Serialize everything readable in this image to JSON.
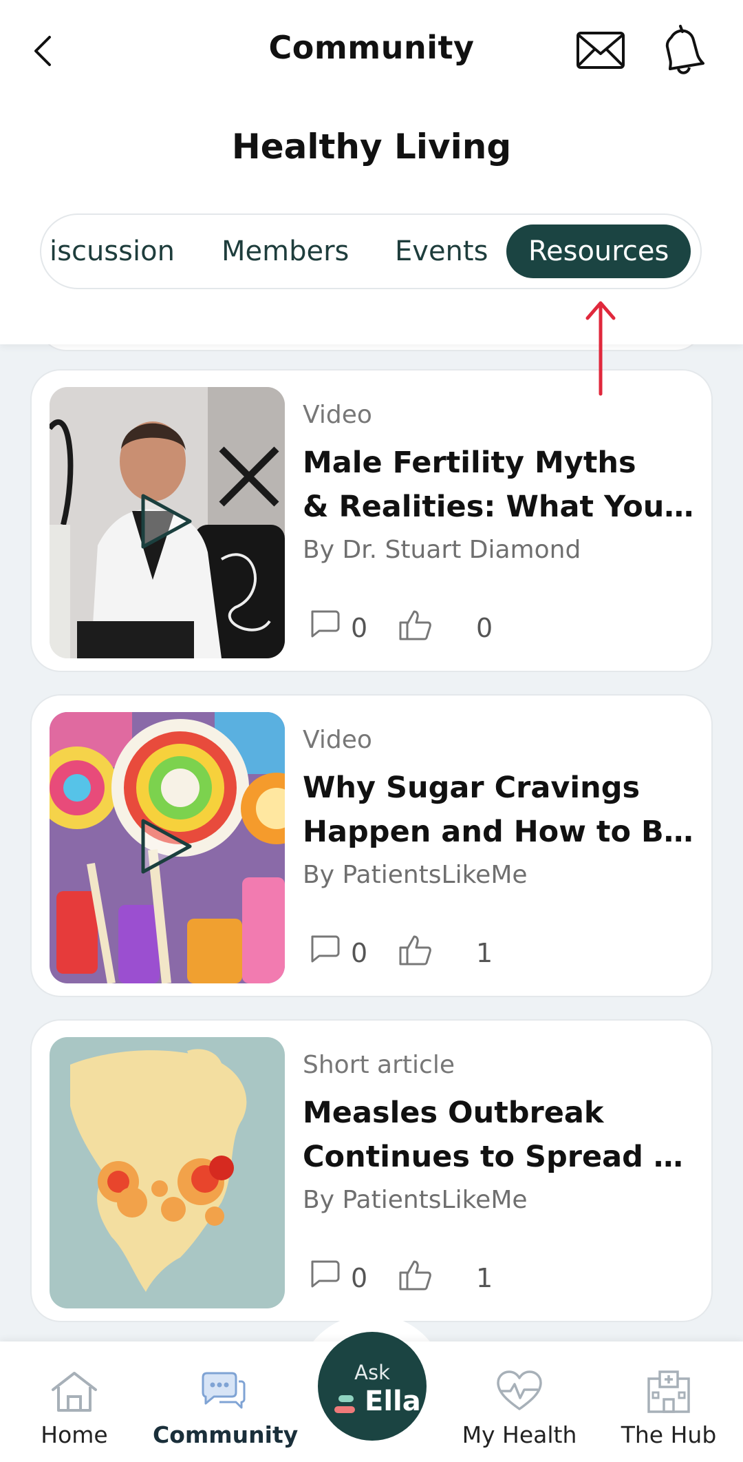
{
  "header": {
    "title": "Community",
    "group_title": "Healthy Living"
  },
  "tabs": [
    {
      "label": "iscussion",
      "active": false
    },
    {
      "label": "Members",
      "active": false
    },
    {
      "label": "Events",
      "active": false
    },
    {
      "label": "Resources",
      "active": true
    }
  ],
  "resources": [
    {
      "type": "Video",
      "title_line1": "Male Fertility Myths",
      "title_line2": "& Realities: What You N...",
      "author": "By Dr. Stuart Diamond",
      "comments": "0",
      "likes": "0",
      "thumbnail": "doctor-video-thumbnail"
    },
    {
      "type": "Video",
      "title_line1": "Why Sugar Cravings",
      "title_line2": "Happen and How to Be...",
      "author": "By PatientsLikeMe",
      "comments": "0",
      "likes": "1",
      "thumbnail": "candy-video-thumbnail"
    },
    {
      "type": "Short article",
      "title_line1": "Measles Outbreak",
      "title_line2": "Continues to Spread A...",
      "author": "By PatientsLikeMe",
      "comments": "0",
      "likes": "1",
      "thumbnail": "north-america-map-thumbnail"
    }
  ],
  "bottom_nav": {
    "home": "Home",
    "community": "Community",
    "ask_top": "Ask",
    "ask_bottom": "Ella",
    "my_health": "My Health",
    "the_hub": "The Hub"
  },
  "colors": {
    "accent": "#1b4442",
    "background": "#eef2f5",
    "annotation_arrow": "#e0283c",
    "nav_icon": "#a7b0b8",
    "community_icon": "#7fa3d4"
  },
  "icons": {
    "back": "chevron-left-icon",
    "mail": "envelope-icon",
    "notifications": "bell-icon",
    "comment": "speech-bubble-icon",
    "like": "thumbs-up-icon",
    "play": "play-icon"
  }
}
